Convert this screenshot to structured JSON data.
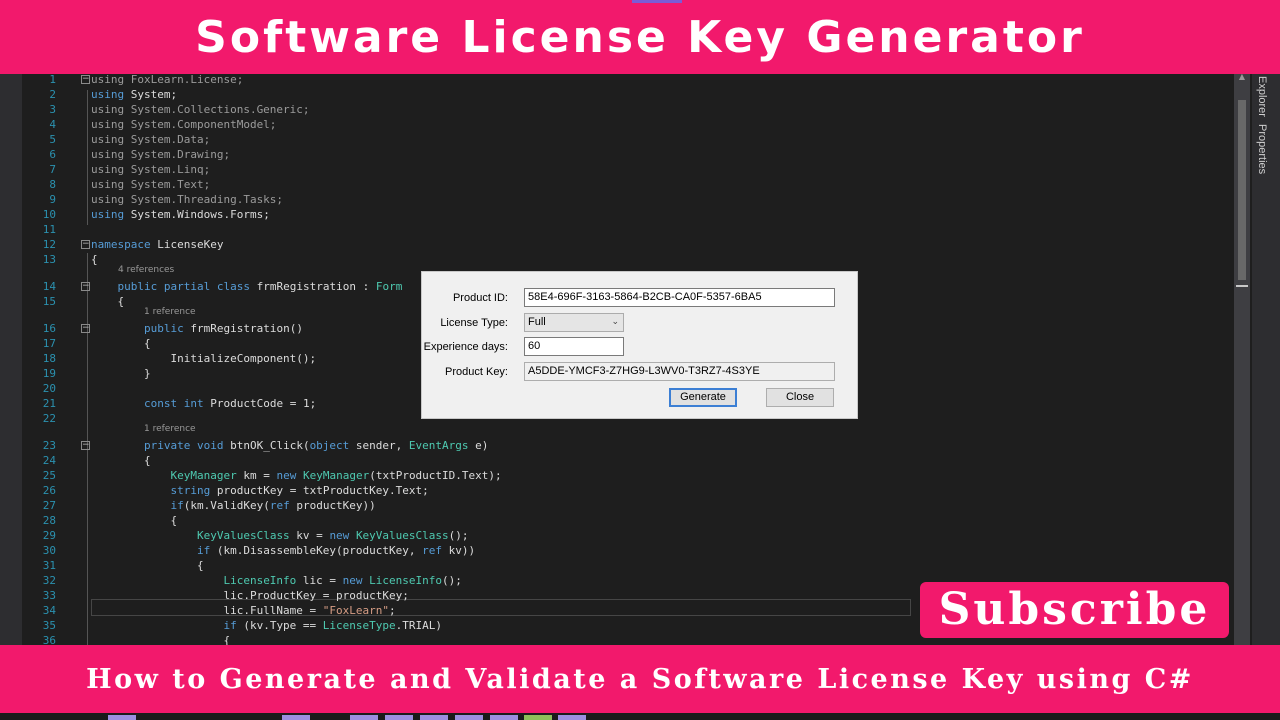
{
  "banner": {
    "title": "Software License Key Generator",
    "subtitle": "How to Generate and Validate a Software License Key using C#",
    "subscribe": "Subscribe"
  },
  "side_tabs": [
    "Explorer",
    "Properties"
  ],
  "code_lines": [
    {
      "n": "1",
      "t": "using FoxLearn.License;"
    },
    {
      "n": "2",
      "t": "using System;"
    },
    {
      "n": "3",
      "t": "using System.Collections.Generic;"
    },
    {
      "n": "4",
      "t": "using System.ComponentModel;"
    },
    {
      "n": "5",
      "t": "using System.Data;"
    },
    {
      "n": "6",
      "t": "using System.Drawing;"
    },
    {
      "n": "7",
      "t": "using System.Linq;"
    },
    {
      "n": "8",
      "t": "using System.Text;"
    },
    {
      "n": "9",
      "t": "using System.Threading.Tasks;"
    },
    {
      "n": "10",
      "t": "using System.Windows.Forms;"
    },
    {
      "n": "11",
      "t": ""
    },
    {
      "n": "12",
      "t": "namespace LicenseKey"
    },
    {
      "n": "13",
      "t": "{"
    },
    {
      "n": "14",
      "t": "    public partial class frmRegistration : Form"
    },
    {
      "n": "15",
      "t": "    {"
    },
    {
      "n": "16",
      "t": "        public frmRegistration()"
    },
    {
      "n": "17",
      "t": "        {"
    },
    {
      "n": "18",
      "t": "            InitializeComponent();"
    },
    {
      "n": "19",
      "t": "        }"
    },
    {
      "n": "20",
      "t": ""
    },
    {
      "n": "21",
      "t": "        const int ProductCode = 1;"
    },
    {
      "n": "22",
      "t": ""
    },
    {
      "n": "23",
      "t": "        private void btnOK_Click(object sender, EventArgs e)"
    },
    {
      "n": "24",
      "t": "        {"
    },
    {
      "n": "25",
      "t": "            KeyManager km = new KeyManager(txtProductID.Text);"
    },
    {
      "n": "26",
      "t": "            string productKey = txtProductKey.Text;"
    },
    {
      "n": "27",
      "t": "            if(km.ValidKey(ref productKey))"
    },
    {
      "n": "28",
      "t": "            {"
    },
    {
      "n": "29",
      "t": "                KeyValuesClass kv = new KeyValuesClass();"
    },
    {
      "n": "30",
      "t": "                if (km.DisassembleKey(productKey, ref kv))"
    },
    {
      "n": "31",
      "t": "                {"
    },
    {
      "n": "32",
      "t": "                    LicenseInfo lic = new LicenseInfo();"
    },
    {
      "n": "33",
      "t": "                    lic.ProductKey = productKey;"
    },
    {
      "n": "34",
      "t": "                    lic.FullName = \"FoxLearn\";"
    },
    {
      "n": "35",
      "t": "                    if (kv.Type == LicenseType.TRIAL)"
    },
    {
      "n": "36",
      "t": "                    {"
    }
  ],
  "references": {
    "class_refs": "4 references",
    "ctor_refs": "1 reference",
    "click_refs": "1 reference"
  },
  "dialog": {
    "product_id_label": "Product ID:",
    "product_id_value": "58E4-696F-3163-5864-B2CB-CA0F-5357-6BA5",
    "license_type_label": "License Type:",
    "license_type_value": "Full",
    "experience_days_label": "Experience days:",
    "experience_days_value": "60",
    "product_key_label": "Product Key:",
    "product_key_value": "A5DDE-YMCF3-Z7HG9-L3WV0-T3RZ7-4S3YE",
    "generate_label": "Generate",
    "close_label": "Close"
  },
  "colors": {
    "banner": "#f2196c",
    "editor_bg": "#1e1e1e",
    "keyword": "#569cd6",
    "type": "#4ec9b0",
    "string": "#d69d85",
    "line_number": "#2b91af"
  }
}
